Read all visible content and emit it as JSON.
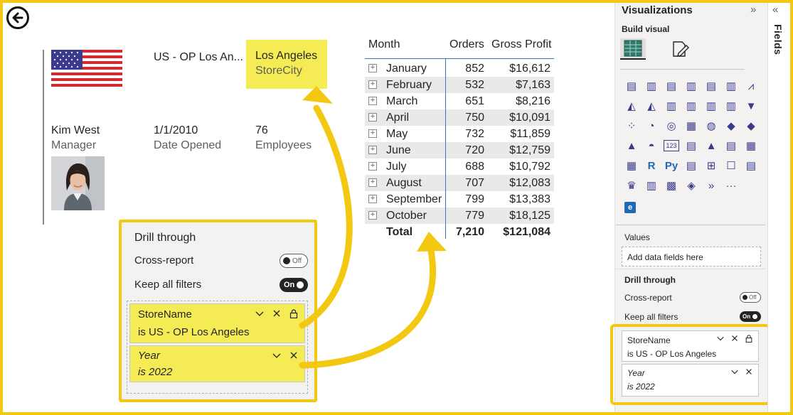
{
  "store": {
    "name_truncated": "US - OP Los An...",
    "city_value": "Los Angeles",
    "city_label": "StoreCity",
    "manager_name": "Kim West",
    "manager_label": "Manager",
    "date_opened": "1/1/2010",
    "date_opened_label": "Date Opened",
    "employees": "76",
    "employees_label": "Employees"
  },
  "table": {
    "headers": [
      "Month",
      "Orders",
      "Gross Profit"
    ],
    "rows": [
      {
        "month": "January",
        "orders": "852",
        "profit": "$16,612"
      },
      {
        "month": "February",
        "orders": "532",
        "profit": "$7,163"
      },
      {
        "month": "March",
        "orders": "651",
        "profit": "$8,216"
      },
      {
        "month": "April",
        "orders": "750",
        "profit": "$10,091"
      },
      {
        "month": "May",
        "orders": "732",
        "profit": "$11,859"
      },
      {
        "month": "June",
        "orders": "720",
        "profit": "$12,759"
      },
      {
        "month": "July",
        "orders": "688",
        "profit": "$10,792"
      },
      {
        "month": "August",
        "orders": "707",
        "profit": "$12,083"
      },
      {
        "month": "September",
        "orders": "799",
        "profit": "$13,383"
      },
      {
        "month": "October",
        "orders": "779",
        "profit": "$18,125"
      }
    ],
    "total": {
      "label": "Total",
      "orders": "7,210",
      "profit": "$121,084"
    },
    "expand_glyph": "+"
  },
  "drill_callout": {
    "title": "Drill through",
    "cross_report_label": "Cross-report",
    "cross_report_toggle": "Off",
    "keep_filters_label": "Keep all filters",
    "keep_filters_toggle": "On",
    "filters": [
      {
        "name": "StoreName",
        "value": "is US - OP Los Angeles"
      },
      {
        "name": "Year",
        "value": "is 2022"
      }
    ]
  },
  "viz_pane": {
    "title": "Visualizations",
    "collapse_glyph": "»",
    "build_visual_label": "Build visual",
    "values_label": "Values",
    "add_fields_placeholder": "Add data fields here",
    "drill_title": "Drill through",
    "cross_report_label": "Cross-report",
    "cross_report_toggle": "Off",
    "keep_filters_label": "Keep all filters",
    "keep_filters_toggle": "On",
    "filters": [
      {
        "name": "StoreName",
        "value": "is US - OP Los Angeles"
      },
      {
        "name": "Year",
        "value": "is 2022"
      }
    ],
    "gallery_icons": [
      "stacked-bar-chart-icon",
      "stacked-column-chart-icon",
      "clustered-bar-chart-icon",
      "clustered-column-chart-icon",
      "100-stacked-bar-chart-icon",
      "100-stacked-column-chart-icon",
      "line-chart-icon",
      "area-chart-icon",
      "stacked-area-chart-icon",
      "line-stacked-column-icon",
      "line-clustered-column-icon",
      "ribbon-chart-icon",
      "waterfall-chart-icon",
      "funnel-chart-icon",
      "scatter-chart-icon",
      "pie-chart-icon",
      "donut-chart-icon",
      "treemap-icon",
      "map-icon",
      "filled-map-icon",
      "shape-map-icon",
      "azure-map-icon",
      "gauge-icon",
      "card-icon",
      "multi-row-card-icon",
      "kpi-icon",
      "slicer-icon",
      "table-icon",
      "matrix-icon",
      "r-visual-icon",
      "python-visual-icon",
      "key-influencers-icon",
      "decomposition-tree-icon",
      "qa-icon",
      "smart-narrative-icon",
      "trophy-icon",
      "paginated-report-icon",
      "power-apps-icon",
      "power-automate-icon",
      "arcgis-icon",
      "more-visuals-icon"
    ],
    "gallery_glyphs": [
      "▤",
      "▥",
      "▤",
      "▥",
      "▤",
      "▥",
      "⩘",
      "◭",
      "◭",
      "▥",
      "▥",
      "▥",
      "▥",
      "▼",
      "⁘",
      "◔",
      "◎",
      "▦",
      "◍",
      "◆",
      "◆",
      "▲",
      "◓",
      "123",
      "▤",
      "▲",
      "▤",
      "▦",
      "▦",
      "R",
      "Py",
      "▤",
      "⊞",
      "☐",
      "▤",
      "♛",
      "▥",
      "▩",
      "◈",
      "»",
      "···"
    ],
    "custom_visual_glyph": "e"
  },
  "fields_pane": {
    "label": "Fields",
    "collapse_glyph": "«"
  },
  "colors": {
    "highlight_yellow": "#f5ec55",
    "callout_border": "#f2c811",
    "table_accent": "#2b79c2"
  }
}
